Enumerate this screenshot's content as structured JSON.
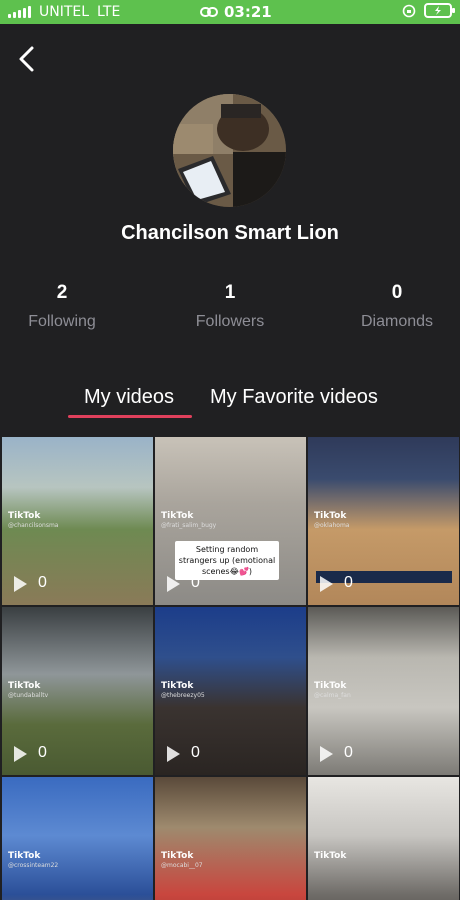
{
  "status_bar": {
    "carrier": "UNITEL",
    "network": "LTE",
    "time": "03:21"
  },
  "profile": {
    "name": "Chancilson Smart Lion"
  },
  "stats": [
    {
      "value": "2",
      "label": "Following"
    },
    {
      "value": "1",
      "label": "Followers"
    },
    {
      "value": "0",
      "label": "Diamonds"
    }
  ],
  "tabs": [
    {
      "label": "My videos",
      "active": true
    },
    {
      "label": "My Favorite videos",
      "active": false
    }
  ],
  "videos": [
    {
      "views": "0",
      "bg": "linear-gradient(180deg,#9ab3c8 0%,#b7c5c0 30%,#6e8a52 55%,#8a7a58 100%)",
      "tiktok_user": "@chancilsonsma"
    },
    {
      "views": "0",
      "bg": "linear-gradient(180deg,#c8c2b8 0%,#a9a49c 40%,#8c8a86 100%)",
      "tiktok_user": "@frati_salim_bugy",
      "caption": "Setting random strangers up (emotional scenes😂💕)"
    },
    {
      "views": "0",
      "bg": "linear-gradient(180deg,#2f3a5a 0%,#3a4b6e 25%,#c59a68 55%,#b2875a 100%)",
      "tiktok_user": "@oklahoma"
    },
    {
      "views": "0",
      "bg": "linear-gradient(180deg,#3a3f42 0%,#8f9699 40%,#5a6b3c 70%,#4a5a32 100%)",
      "tiktok_user": "@tundaballtv"
    },
    {
      "views": "0",
      "bg": "linear-gradient(180deg,#1c3d8a 0%,#2f4f8c 30%,#3a3330 60%,#2a2522 100%)",
      "tiktok_user": "@thebreezy05"
    },
    {
      "views": "0",
      "bg": "linear-gradient(180deg,#5b5a56 0%,#b9b7b0 30%,#c8c6c0 60%,#7d7b76 100%)",
      "tiktok_user": "@calma_fan"
    },
    {
      "views": "",
      "bg": "linear-gradient(180deg,#3a6bc0 0%,#5d8ad2 35%,#2b4f98 70%,#8a6a52 100%)",
      "tiktok_user": "@crossinteam22"
    },
    {
      "views": "",
      "bg": "linear-gradient(180deg,#5a4a3a 0%,#9e8a6e 30%,#c9463e 70%,#8a2f2a 100%)",
      "tiktok_user": "@mocabi__07"
    },
    {
      "views": "",
      "bg": "linear-gradient(180deg,#e8e6e2 0%,#c7c5c1 35%,#6f6c68 70%,#3a3836 100%)",
      "tiktok_user": ""
    }
  ],
  "tiktok_label": "TikTok",
  "colors": {
    "status_bar": "#5ec14e",
    "background": "#202022",
    "tab_underline": "#e0405c",
    "muted_text": "#8e8e96"
  }
}
